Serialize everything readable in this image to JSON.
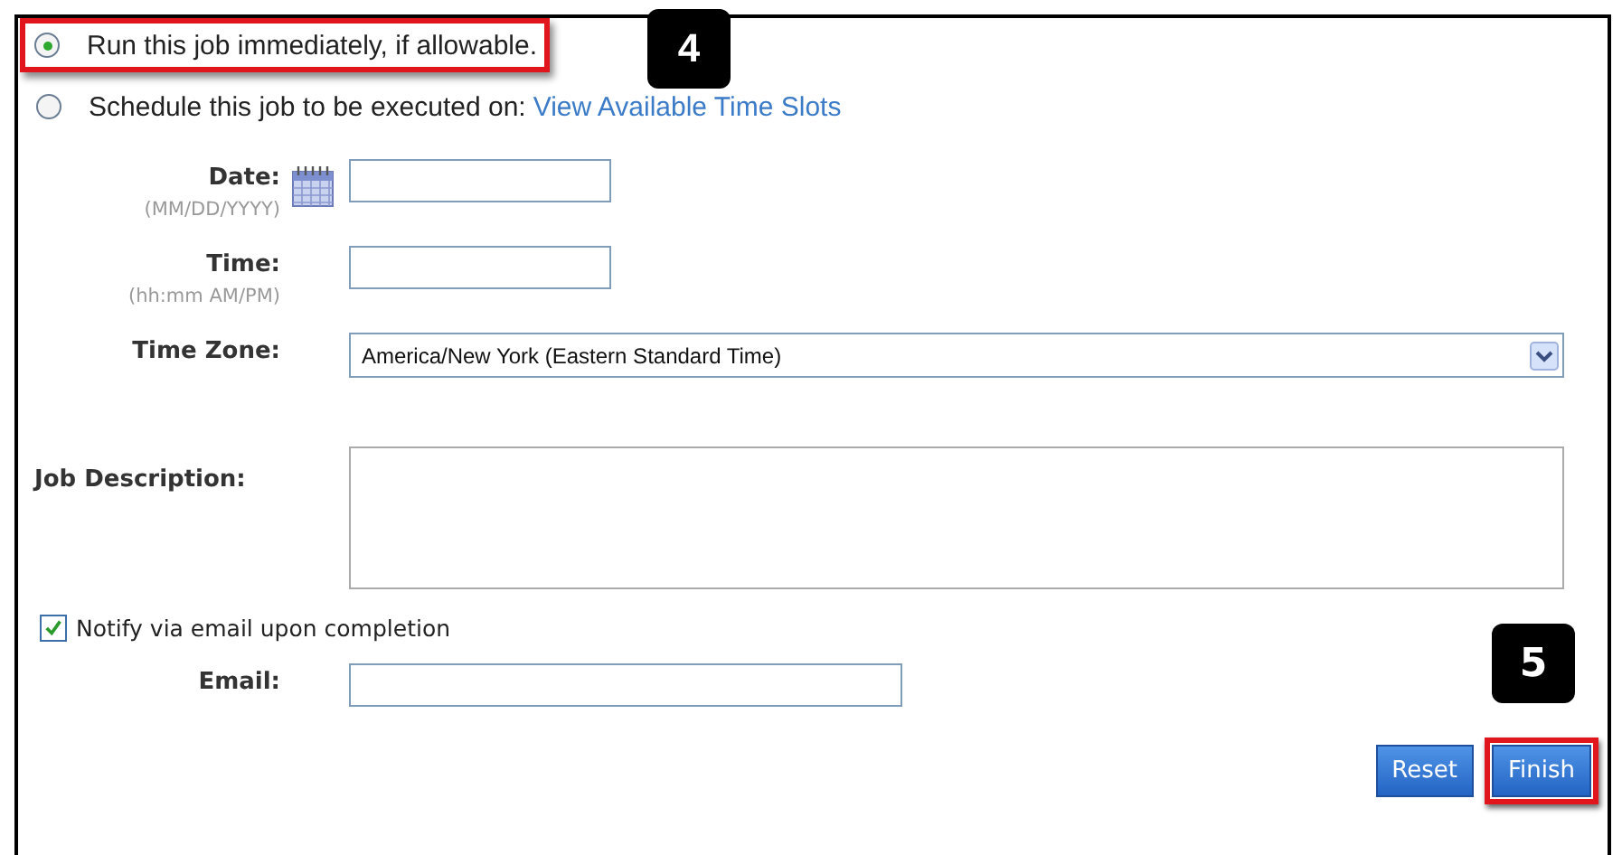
{
  "schedule_options": [
    {
      "label": "Run this job immediately, if allowable.",
      "selected": true,
      "highlighted": true
    },
    {
      "label": "Schedule this job to be executed on:",
      "selected": false,
      "highlighted": false,
      "link": "View Available Time Slots"
    }
  ],
  "date": {
    "label": "Date:",
    "hint": "(MM/DD/YYYY)"
  },
  "time": {
    "label": "Time:",
    "hint": "(hh:mm AM/PM)"
  },
  "time_zone": {
    "label": "Time Zone:",
    "value": "America/New York (Eastern Standard Time)"
  },
  "job_description": {
    "label": "Job Description:"
  },
  "notify": {
    "label": "Notify via email upon completion",
    "checked": true
  },
  "email": {
    "label": "Email:"
  },
  "buttons": [
    {
      "label": "Reset",
      "highlighted": false
    },
    {
      "label": "Finish",
      "highlighted": true
    }
  ],
  "callouts": [
    "4",
    "5"
  ]
}
